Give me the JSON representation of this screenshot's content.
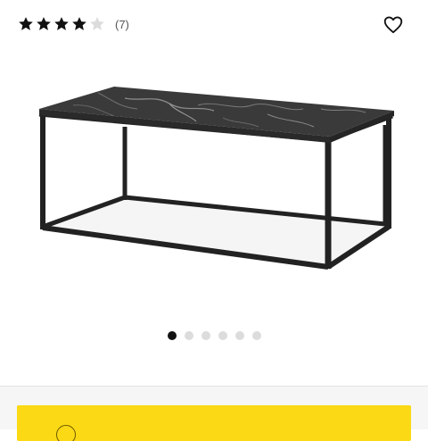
{
  "rating": {
    "stars_filled": 4,
    "stars_total": 5,
    "review_count": "(7)",
    "star_color": "#111111",
    "star_empty_color": "#dcdcdc"
  },
  "favorite": {
    "icon": "heart-outline-icon"
  },
  "product": {
    "image": "coffee-table-black-marble-metal-frame"
  },
  "carousel": {
    "total": 6,
    "active_index": 0
  },
  "cta": {
    "color": "#fbd914",
    "icon": "cart-icon"
  }
}
